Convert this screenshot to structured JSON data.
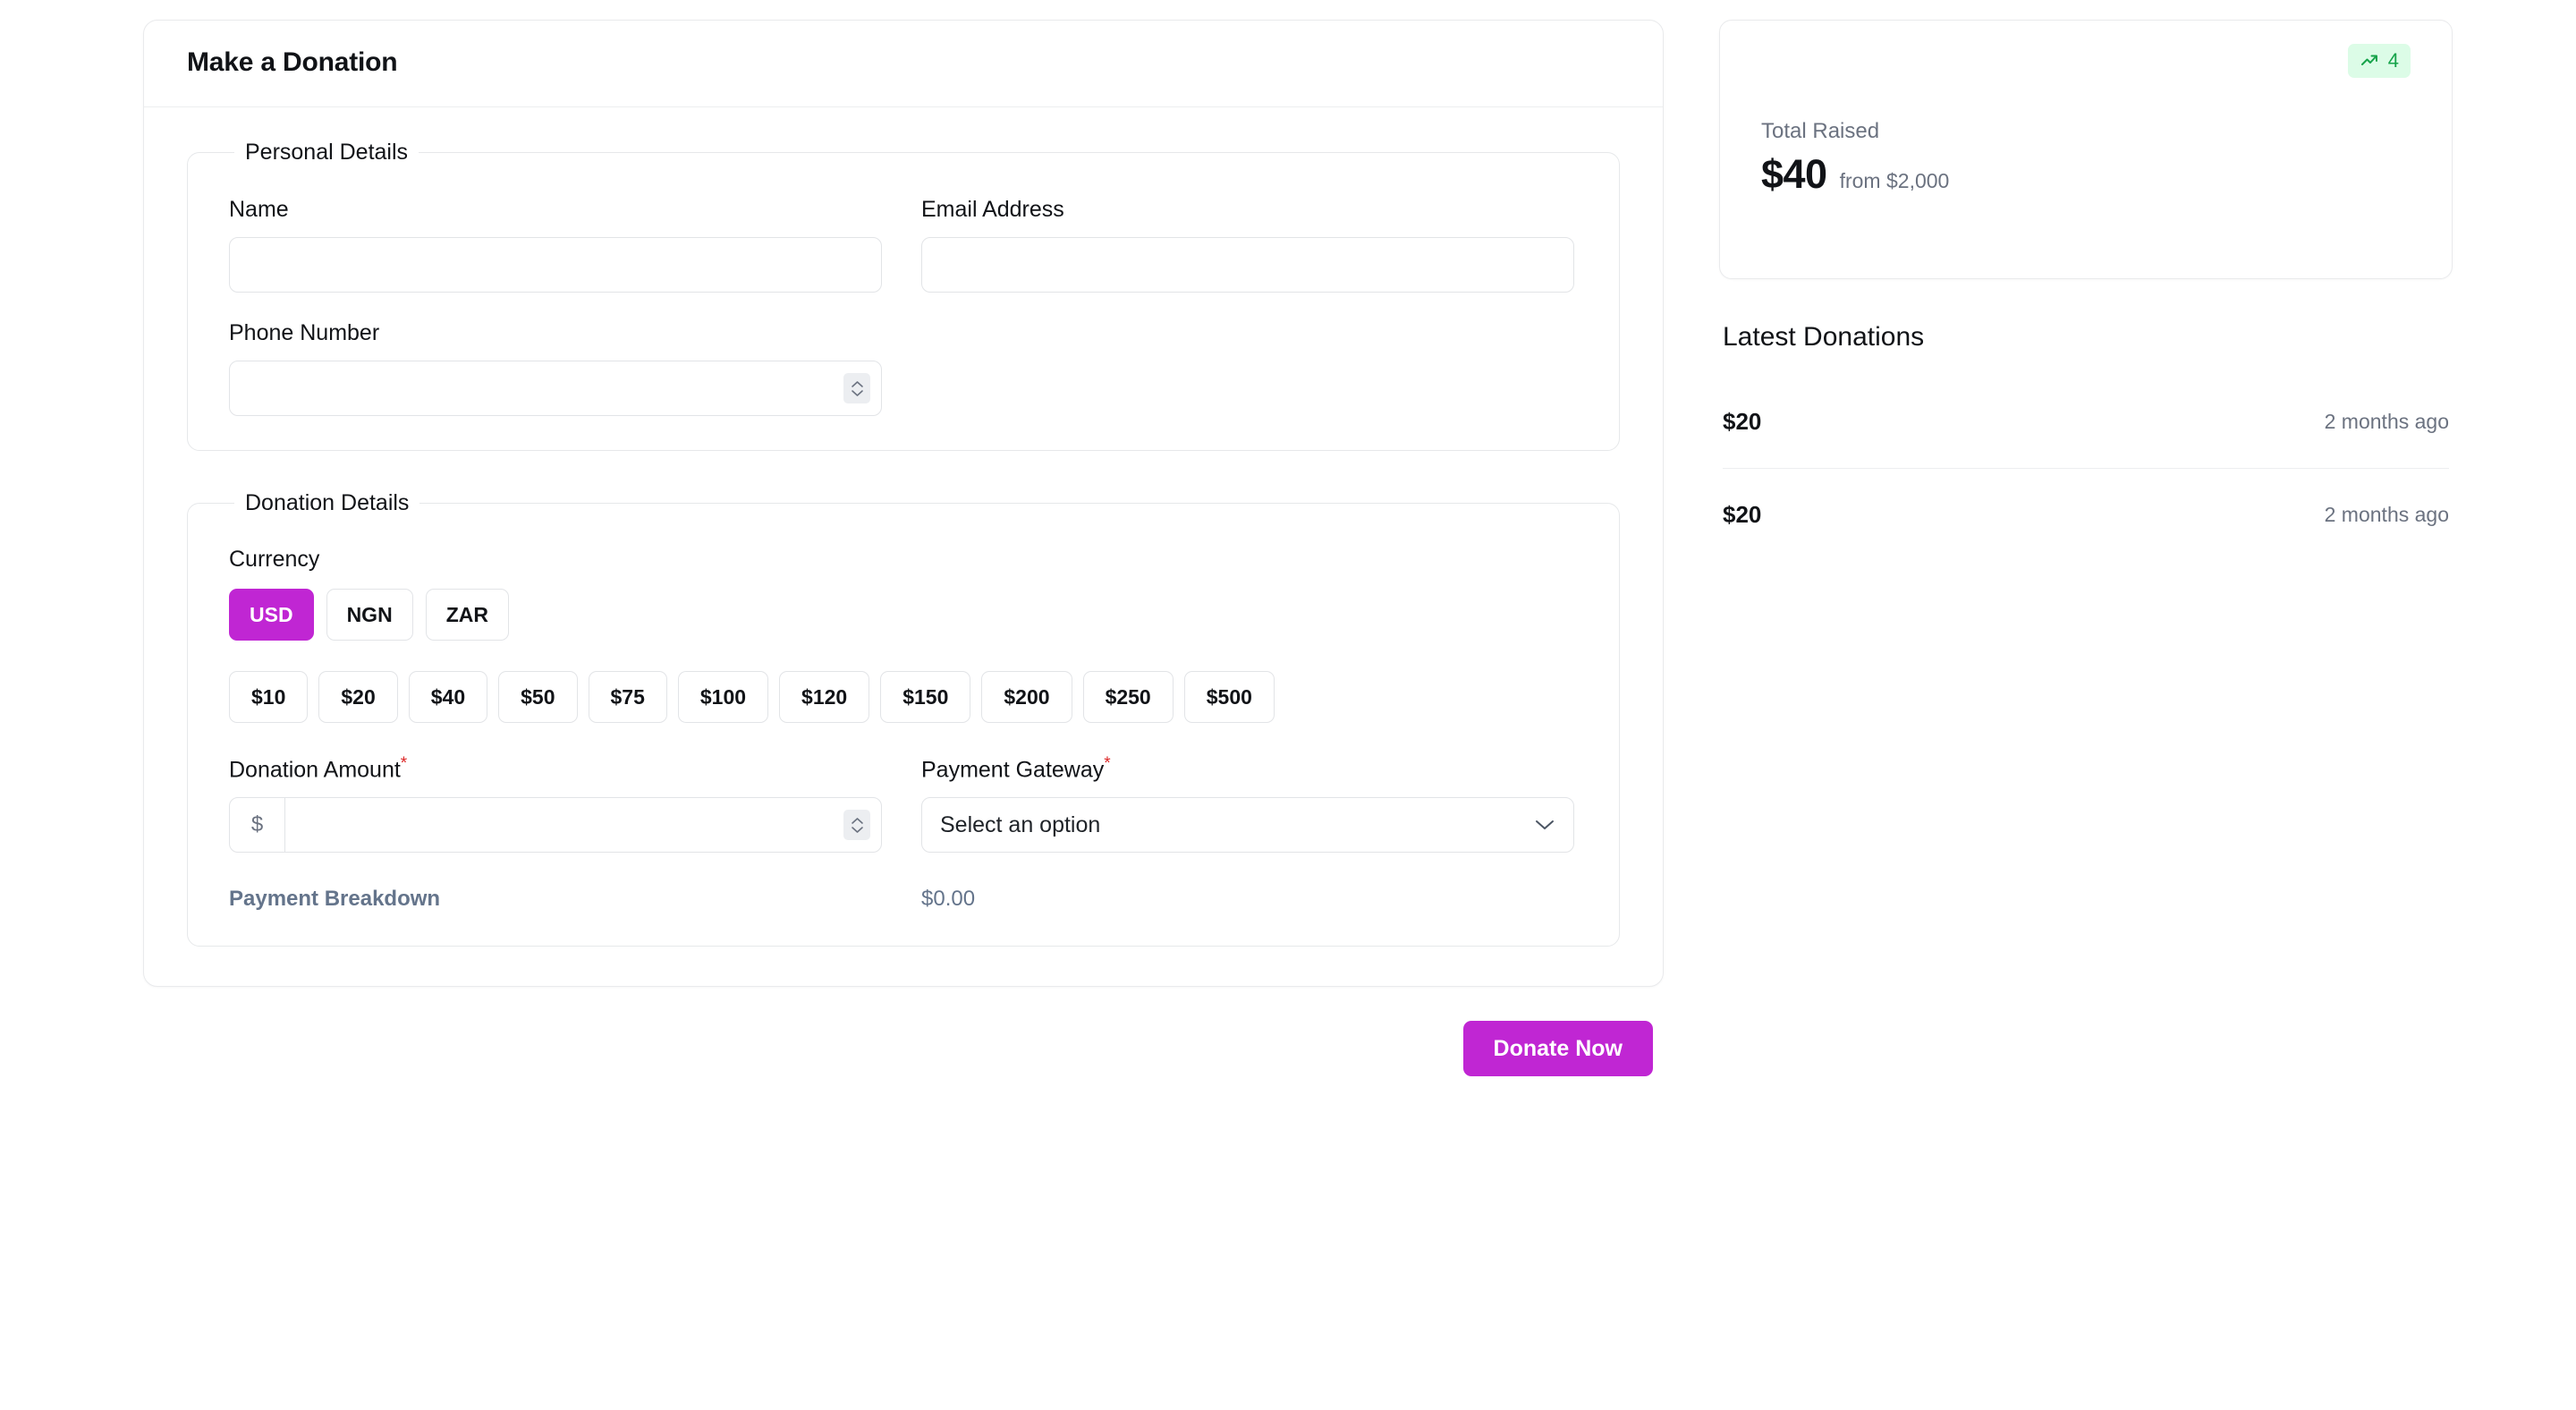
{
  "form_card": {
    "title": "Make a Donation",
    "personal_details": {
      "legend": "Personal Details",
      "name": {
        "label": "Name",
        "value": "",
        "placeholder": ""
      },
      "email": {
        "label": "Email Address",
        "value": "",
        "placeholder": ""
      },
      "phone": {
        "label": "Phone Number",
        "value": "",
        "placeholder": ""
      }
    },
    "donation_details": {
      "legend": "Donation Details",
      "currency_label": "Currency",
      "currencies": [
        {
          "code": "USD",
          "active": true
        },
        {
          "code": "NGN",
          "active": false
        },
        {
          "code": "ZAR",
          "active": false
        }
      ],
      "preset_amounts": [
        "$10",
        "$20",
        "$40",
        "$50",
        "$75",
        "$100",
        "$120",
        "$150",
        "$200",
        "$250",
        "$500"
      ],
      "amount_field": {
        "label": "Donation Amount",
        "required_marker": "*",
        "currency_symbol": "$",
        "value": "",
        "placeholder": ""
      },
      "gateway_field": {
        "label": "Payment Gateway",
        "required_marker": "*",
        "selected": "Select an option"
      },
      "breakdown": {
        "label": "Payment Breakdown",
        "value": "$0.00"
      }
    },
    "submit_label": "Donate Now"
  },
  "sidebar": {
    "stat_card": {
      "badge_count": "4",
      "label": "Total Raised",
      "value": "$40",
      "goal_text": "from $2,000"
    },
    "latest_donations": {
      "title": "Latest Donations",
      "items": [
        {
          "amount": "$20",
          "time": "2 months ago"
        },
        {
          "amount": "$20",
          "time": "2 months ago"
        }
      ]
    }
  },
  "colors": {
    "accent": "#C026D3",
    "success": "#16A34A",
    "success_bg": "#DCFCE7",
    "required": "#DC2626",
    "muted": "#6B7280",
    "slate": "#64748B"
  }
}
